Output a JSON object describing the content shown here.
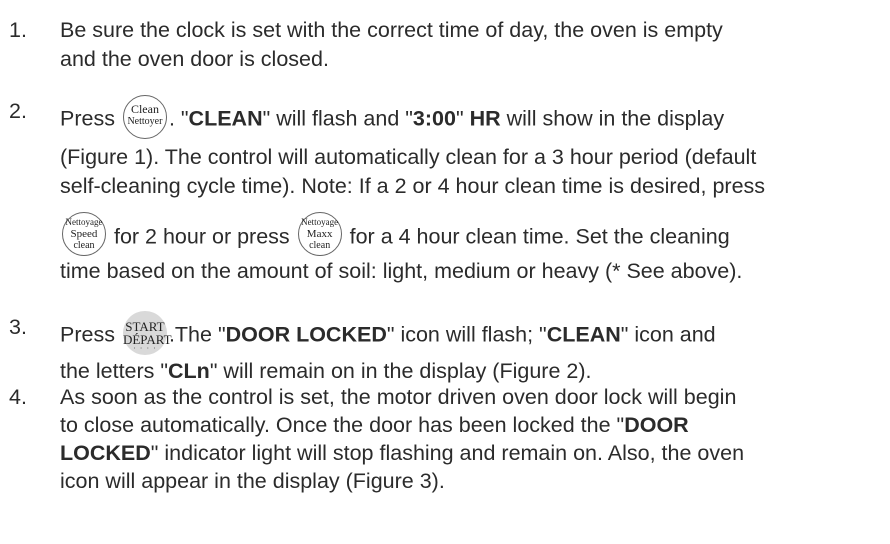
{
  "steps": {
    "s1": {
      "num": "1.",
      "l1": "Be sure the clock is set with the correct time of day, the oven is empty",
      "l2": "and the oven door is closed."
    },
    "s2": {
      "num": "2.",
      "press": "Press",
      "clean_btn": {
        "top": "Clean",
        "bottom": "Nettoyer"
      },
      "after_btn_1": ". \"",
      "clean_word": "CLEAN",
      "after_btn_2": "\" will flash and \"",
      "time_value": "3:00",
      "after_btn_3": "\" ",
      "hr": "HR",
      "after_btn_4": " will show in the display",
      "l2": "(Figure 1). The control will automatically clean for a 3 hour period (default",
      "l3": "self-cleaning cycle time). Note: If a 2 or 4 hour clean time is desired, press",
      "speed_btn": {
        "top": "Nettoyage",
        "mid": "Speed",
        "bottom": "clean"
      },
      "l4a": "for 2 hour or press",
      "maxx_btn": {
        "top": "Nettoyage",
        "mid": "Maxx",
        "bottom": "clean"
      },
      "l4b": "for a 4 hour clean time. Set the cleaning",
      "l5": "time based on the amount of soil: light, medium or heavy (* See above)."
    },
    "s3": {
      "num": "3.",
      "press": "Press",
      "start_btn": {
        "top": "START",
        "bottom": "DÉPART",
        "dots": "· · · ·"
      },
      "l1a": ".The \"",
      "door_locked": "DOOR LOCKED",
      "l1b": "\" icon will flash; \"",
      "clean_word": "CLEAN",
      "l1c": "\" icon and",
      "l2a": "the letters \"",
      "cln": "CLn",
      "l2b": "\" will remain on in the display (Figure 2)."
    },
    "s4": {
      "num": "4.",
      "l1": "As soon as the control is set, the motor driven oven door lock will begin",
      "l2a": "to close automatically. Once the door has been locked the \"",
      "door": "DOOR",
      "locked": "LOCKED",
      "l3b": "\" indicator light will stop flashing and remain on. Also, the oven",
      "l4": "icon will appear in the display (Figure 3)."
    }
  }
}
